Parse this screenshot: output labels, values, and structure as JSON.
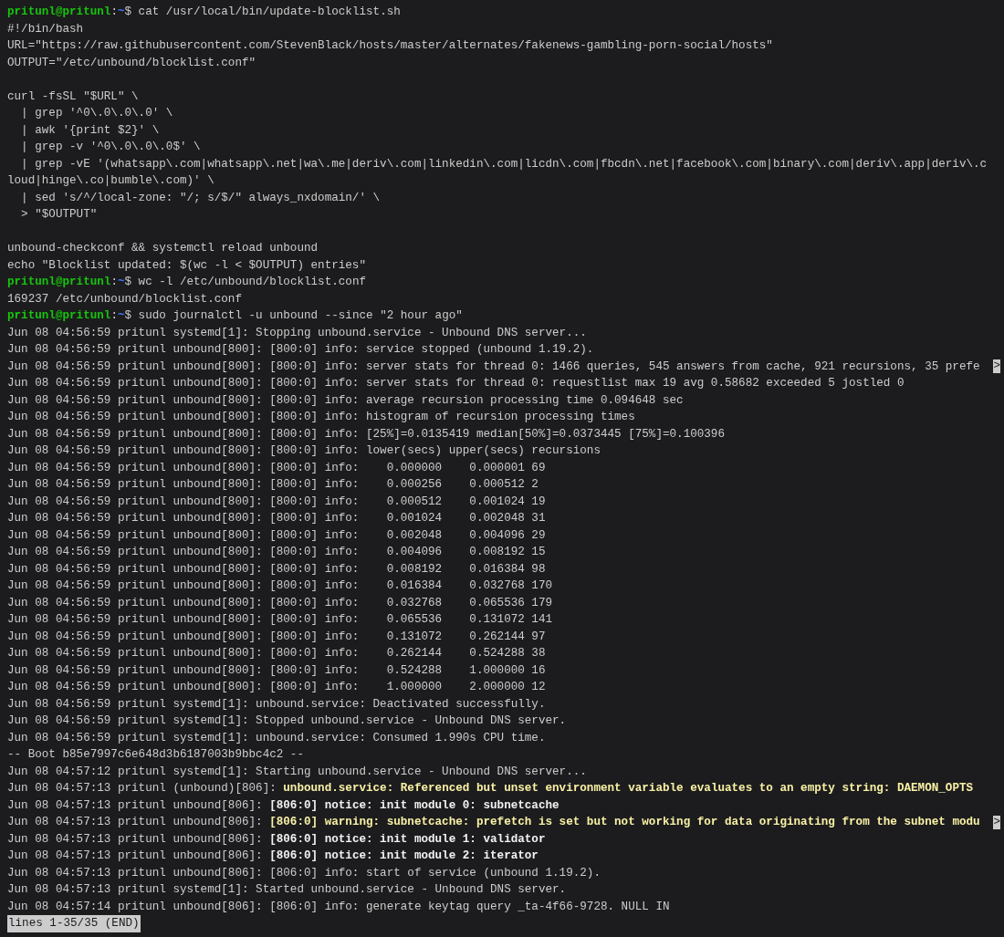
{
  "terminal": {
    "lines": [
      {
        "kind": "command",
        "segments": [
          {
            "text": "pritunl@pritunl",
            "kind": "user"
          },
          {
            "text": ":",
            "kind": "plain"
          },
          {
            "text": "~",
            "kind": "path"
          },
          {
            "text": "$ cat /usr/local/bin/update-blocklist.sh",
            "kind": "plain"
          }
        ]
      },
      {
        "kind": "output",
        "segments": [
          {
            "text": "#!/bin/bash",
            "kind": "plain"
          }
        ]
      },
      {
        "kind": "output",
        "segments": [
          {
            "text": "URL=\"https://raw.githubusercontent.com/StevenBlack/hosts/master/alternates/fakenews-gambling-porn-social/hosts\"",
            "kind": "plain"
          }
        ]
      },
      {
        "kind": "output",
        "segments": [
          {
            "text": "OUTPUT=\"/etc/unbound/blocklist.conf\"",
            "kind": "plain"
          }
        ]
      },
      {
        "kind": "blank"
      },
      {
        "kind": "output",
        "segments": [
          {
            "text": "curl -fsSL \"$URL\" \\",
            "kind": "plain"
          }
        ]
      },
      {
        "kind": "output",
        "segments": [
          {
            "text": "  | grep '^0\\.0\\.0\\.0' \\",
            "kind": "plain"
          }
        ]
      },
      {
        "kind": "output",
        "segments": [
          {
            "text": "  | awk '{print $2}' \\",
            "kind": "plain"
          }
        ]
      },
      {
        "kind": "output",
        "segments": [
          {
            "text": "  | grep -v '^0\\.0\\.0\\.0$' \\",
            "kind": "plain"
          }
        ]
      },
      {
        "kind": "output",
        "segments": [
          {
            "text": "  | grep -vE '(whatsapp\\.com|whatsapp\\.net|wa\\.me|deriv\\.com|linkedin\\.com|licdn\\.com|fbcdn\\.net|facebook\\.com|binary\\.com|deriv\\.app|deriv\\.c",
            "kind": "plain"
          }
        ]
      },
      {
        "kind": "output",
        "segments": [
          {
            "text": "loud|hinge\\.co|bumble\\.com)' \\",
            "kind": "plain"
          }
        ]
      },
      {
        "kind": "output",
        "segments": [
          {
            "text": "  | sed 's/^/local-zone: \"/; s/$/\" always_nxdomain/' \\",
            "kind": "plain"
          }
        ]
      },
      {
        "kind": "output",
        "segments": [
          {
            "text": "  > \"$OUTPUT\"",
            "kind": "plain"
          }
        ]
      },
      {
        "kind": "blank"
      },
      {
        "kind": "output",
        "segments": [
          {
            "text": "unbound-checkconf && systemctl reload unbound",
            "kind": "plain"
          }
        ]
      },
      {
        "kind": "output",
        "segments": [
          {
            "text": "echo \"Blocklist updated: $(wc -l < $OUTPUT) entries\"",
            "kind": "plain"
          }
        ]
      },
      {
        "kind": "command",
        "segments": [
          {
            "text": "pritunl@pritunl",
            "kind": "user"
          },
          {
            "text": ":",
            "kind": "plain"
          },
          {
            "text": "~",
            "kind": "path"
          },
          {
            "text": "$ wc -l /etc/unbound/blocklist.conf",
            "kind": "plain"
          }
        ]
      },
      {
        "kind": "output",
        "segments": [
          {
            "text": "169237 /etc/unbound/blocklist.conf",
            "kind": "plain"
          }
        ]
      },
      {
        "kind": "command",
        "segments": [
          {
            "text": "pritunl@pritunl",
            "kind": "user"
          },
          {
            "text": ":",
            "kind": "plain"
          },
          {
            "text": "~",
            "kind": "path"
          },
          {
            "text": "$ sudo journalctl -u unbound --since \"2 hour ago\"",
            "kind": "plain"
          }
        ]
      },
      {
        "kind": "output",
        "segments": [
          {
            "text": "Jun 08 04:56:59 pritunl systemd[1]: Stopping unbound.service - Unbound DNS server...",
            "kind": "plain"
          }
        ]
      },
      {
        "kind": "output",
        "segments": [
          {
            "text": "Jun 08 04:56:59 pritunl unbound[800]: [800:0] info: service stopped (unbound 1.19.2).",
            "kind": "plain"
          }
        ]
      },
      {
        "kind": "output",
        "marker": ">",
        "segments": [
          {
            "text": "Jun 08 04:56:59 pritunl unbound[800]: [800:0] info: server stats for thread 0: 1466 queries, 545 answers from cache, 921 recursions, 35 prefe",
            "kind": "plain"
          }
        ]
      },
      {
        "kind": "output",
        "segments": [
          {
            "text": "Jun 08 04:56:59 pritunl unbound[800]: [800:0] info: server stats for thread 0: requestlist max 19 avg 0.58682 exceeded 5 jostled 0",
            "kind": "plain"
          }
        ]
      },
      {
        "kind": "output",
        "segments": [
          {
            "text": "Jun 08 04:56:59 pritunl unbound[800]: [800:0] info: average recursion processing time 0.094648 sec",
            "kind": "plain"
          }
        ]
      },
      {
        "kind": "output",
        "segments": [
          {
            "text": "Jun 08 04:56:59 pritunl unbound[800]: [800:0] info: histogram of recursion processing times",
            "kind": "plain"
          }
        ]
      },
      {
        "kind": "output",
        "segments": [
          {
            "text": "Jun 08 04:56:59 pritunl unbound[800]: [800:0] info: [25%]=0.0135419 median[50%]=0.0373445 [75%]=0.100396",
            "kind": "plain"
          }
        ]
      },
      {
        "kind": "output",
        "segments": [
          {
            "text": "Jun 08 04:56:59 pritunl unbound[800]: [800:0] info: lower(secs) upper(secs) recursions",
            "kind": "plain"
          }
        ]
      },
      {
        "kind": "output",
        "segments": [
          {
            "text": "Jun 08 04:56:59 pritunl unbound[800]: [800:0] info:    0.000000    0.000001 69",
            "kind": "plain"
          }
        ]
      },
      {
        "kind": "output",
        "segments": [
          {
            "text": "Jun 08 04:56:59 pritunl unbound[800]: [800:0] info:    0.000256    0.000512 2",
            "kind": "plain"
          }
        ]
      },
      {
        "kind": "output",
        "segments": [
          {
            "text": "Jun 08 04:56:59 pritunl unbound[800]: [800:0] info:    0.000512    0.001024 19",
            "kind": "plain"
          }
        ]
      },
      {
        "kind": "output",
        "segments": [
          {
            "text": "Jun 08 04:56:59 pritunl unbound[800]: [800:0] info:    0.001024    0.002048 31",
            "kind": "plain"
          }
        ]
      },
      {
        "kind": "output",
        "segments": [
          {
            "text": "Jun 08 04:56:59 pritunl unbound[800]: [800:0] info:    0.002048    0.004096 29",
            "kind": "plain"
          }
        ]
      },
      {
        "kind": "output",
        "segments": [
          {
            "text": "Jun 08 04:56:59 pritunl unbound[800]: [800:0] info:    0.004096    0.008192 15",
            "kind": "plain"
          }
        ]
      },
      {
        "kind": "output",
        "segments": [
          {
            "text": "Jun 08 04:56:59 pritunl unbound[800]: [800:0] info:    0.008192    0.016384 98",
            "kind": "plain"
          }
        ]
      },
      {
        "kind": "output",
        "segments": [
          {
            "text": "Jun 08 04:56:59 pritunl unbound[800]: [800:0] info:    0.016384    0.032768 170",
            "kind": "plain"
          }
        ]
      },
      {
        "kind": "output",
        "segments": [
          {
            "text": "Jun 08 04:56:59 pritunl unbound[800]: [800:0] info:    0.032768    0.065536 179",
            "kind": "plain"
          }
        ]
      },
      {
        "kind": "output",
        "segments": [
          {
            "text": "Jun 08 04:56:59 pritunl unbound[800]: [800:0] info:    0.065536    0.131072 141",
            "kind": "plain"
          }
        ]
      },
      {
        "kind": "output",
        "segments": [
          {
            "text": "Jun 08 04:56:59 pritunl unbound[800]: [800:0] info:    0.131072    0.262144 97",
            "kind": "plain"
          }
        ]
      },
      {
        "kind": "output",
        "segments": [
          {
            "text": "Jun 08 04:56:59 pritunl unbound[800]: [800:0] info:    0.262144    0.524288 38",
            "kind": "plain"
          }
        ]
      },
      {
        "kind": "output",
        "segments": [
          {
            "text": "Jun 08 04:56:59 pritunl unbound[800]: [800:0] info:    0.524288    1.000000 16",
            "kind": "plain"
          }
        ]
      },
      {
        "kind": "output",
        "segments": [
          {
            "text": "Jun 08 04:56:59 pritunl unbound[800]: [800:0] info:    1.000000    2.000000 12",
            "kind": "plain"
          }
        ]
      },
      {
        "kind": "output",
        "segments": [
          {
            "text": "Jun 08 04:56:59 pritunl systemd[1]: unbound.service: Deactivated successfully.",
            "kind": "plain"
          }
        ]
      },
      {
        "kind": "output",
        "segments": [
          {
            "text": "Jun 08 04:56:59 pritunl systemd[1]: Stopped unbound.service - Unbound DNS server.",
            "kind": "plain"
          }
        ]
      },
      {
        "kind": "output",
        "segments": [
          {
            "text": "Jun 08 04:56:59 pritunl systemd[1]: unbound.service: Consumed 1.990s CPU time.",
            "kind": "plain"
          }
        ]
      },
      {
        "kind": "output",
        "segments": [
          {
            "text": "-- Boot b85e7997c6e648d3b6187003b9bbc4c2 --",
            "kind": "plain"
          }
        ]
      },
      {
        "kind": "output",
        "segments": [
          {
            "text": "Jun 08 04:57:12 pritunl systemd[1]: Starting unbound.service - Unbound DNS server...",
            "kind": "plain"
          }
        ]
      },
      {
        "kind": "output",
        "segments": [
          {
            "text": "Jun 08 04:57:13 pritunl (unbound)[806]: ",
            "kind": "plain"
          },
          {
            "text": "unbound.service: Referenced but unset environment variable evaluates to an empty string: DAEMON_OPTS",
            "kind": "warn"
          }
        ]
      },
      {
        "kind": "output",
        "segments": [
          {
            "text": "Jun 08 04:57:13 pritunl unbound[806]: ",
            "kind": "plain"
          },
          {
            "text": "[806:0] notice: init module 0: subnetcache",
            "kind": "bold"
          }
        ]
      },
      {
        "kind": "output",
        "marker": ">",
        "segments": [
          {
            "text": "Jun 08 04:57:13 pritunl unbound[806]: ",
            "kind": "plain"
          },
          {
            "text": "[806:0] warning: subnetcache: prefetch is set but not working for data originating from the subnet modu",
            "kind": "warn"
          }
        ]
      },
      {
        "kind": "output",
        "segments": [
          {
            "text": "Jun 08 04:57:13 pritunl unbound[806]: ",
            "kind": "plain"
          },
          {
            "text": "[806:0] notice: init module 1: validator",
            "kind": "bold"
          }
        ]
      },
      {
        "kind": "output",
        "segments": [
          {
            "text": "Jun 08 04:57:13 pritunl unbound[806]: ",
            "kind": "plain"
          },
          {
            "text": "[806:0] notice: init module 2: iterator",
            "kind": "bold"
          }
        ]
      },
      {
        "kind": "output",
        "segments": [
          {
            "text": "Jun 08 04:57:13 pritunl unbound[806]: [806:0] info: start of service (unbound 1.19.2).",
            "kind": "plain"
          }
        ]
      },
      {
        "kind": "output",
        "segments": [
          {
            "text": "Jun 08 04:57:13 pritunl systemd[1]: Started unbound.service - Unbound DNS server.",
            "kind": "plain"
          }
        ]
      },
      {
        "kind": "output",
        "segments": [
          {
            "text": "Jun 08 04:57:14 pritunl unbound[806]: [806:0] info: generate keytag query _ta-4f66-9728. NULL IN",
            "kind": "plain"
          }
        ]
      }
    ],
    "pager_status": "lines 1-35/35 (END)"
  }
}
